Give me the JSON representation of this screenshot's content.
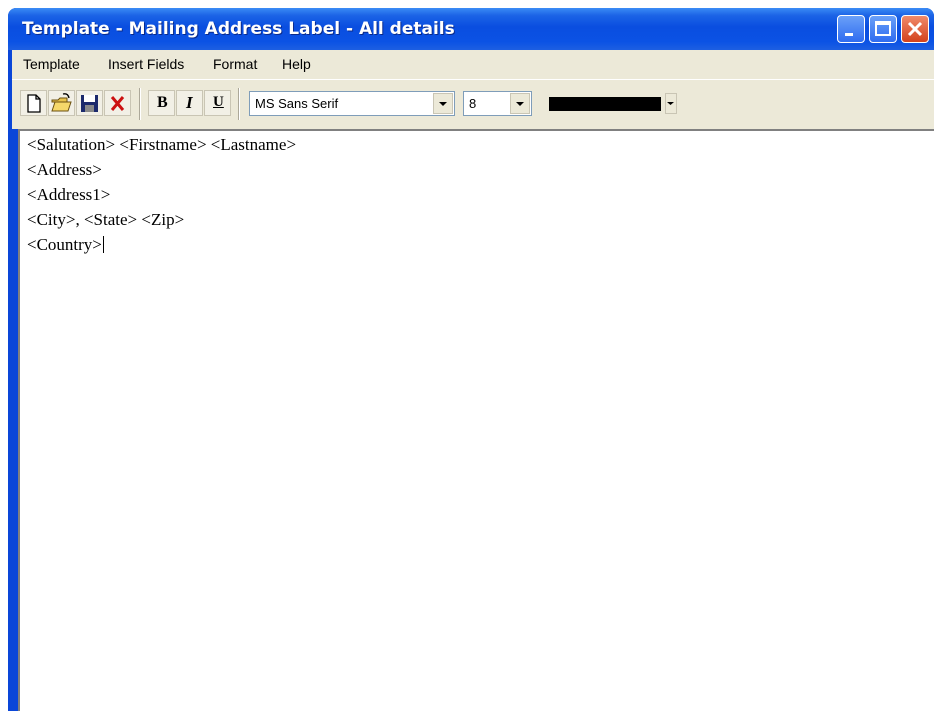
{
  "window": {
    "title": "Template - Mailing Address Label - All details"
  },
  "menu": {
    "items": [
      "Template",
      "Insert Fields",
      "Format",
      "Help"
    ]
  },
  "toolbar": {
    "buttons": [
      "new-document-icon",
      "open-folder-icon",
      "save-icon",
      "delete-icon",
      "bold",
      "italic",
      "underline"
    ],
    "bold_label": "B",
    "italic_label": "I",
    "underline_label": "U",
    "font_name": "MS Sans Serif",
    "font_size": "8",
    "text_color": "#000000"
  },
  "editor": {
    "lines": [
      "<Salutation> <Firstname>  <Lastname>",
      "<Address>",
      "<Address1>",
      "<City>, <State> <Zip>",
      "<Country>"
    ]
  },
  "colors": {
    "titlebar": "#0a4ee0",
    "chrome": "#ece9d8",
    "close_button": "#d3421c"
  }
}
